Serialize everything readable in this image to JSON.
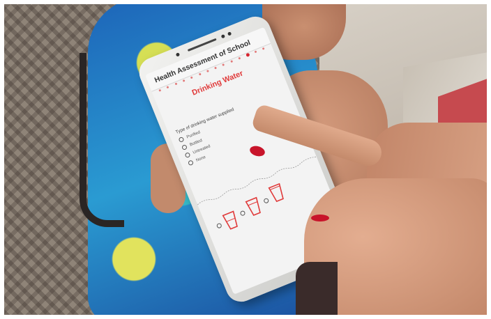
{
  "app": {
    "title": "Health Assessment of School",
    "section_title": "Drinking Water",
    "question": "Type of drinking water supplied",
    "options": [
      "Purified",
      "Bottled",
      "Untreated",
      "None"
    ],
    "progress_step": 12,
    "progress_total": 14
  },
  "colors": {
    "accent": "#e03a3a",
    "nail_polish": "#c8142a"
  },
  "icons": [
    "glass-empty-icon",
    "glass-half-icon",
    "glass-full-icon"
  ]
}
